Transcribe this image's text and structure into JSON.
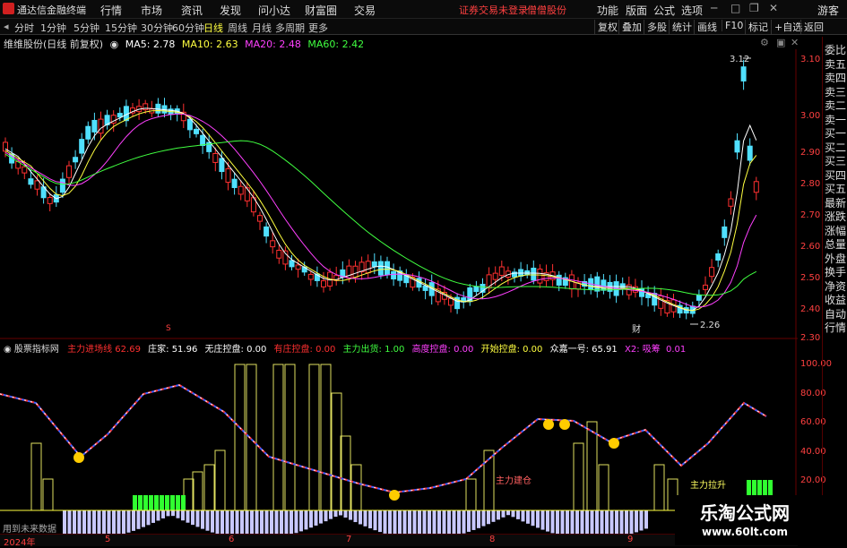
{
  "titlebar": {
    "app_name": "通达信金融终端",
    "menu": [
      "行情",
      "市场",
      "资讯",
      "发现",
      "问小达",
      "财富圈",
      "交易"
    ],
    "notice": "证券交易未登录",
    "notice2": "僧僧股份",
    "right": [
      "功能",
      "版面",
      "公式",
      "选项",
      "游客"
    ]
  },
  "periodbar": {
    "periods": [
      "分时",
      "1分钟",
      "5分钟",
      "15分钟",
      "30分钟",
      "60分钟",
      "日线",
      "周线",
      "月线",
      "多周期",
      "更多"
    ],
    "active": "日线",
    "right": [
      "复权",
      "叠加",
      "多股",
      "统计",
      "画线",
      "F10",
      "标记",
      "+自选",
      "返回"
    ]
  },
  "ma_legend": {
    "title": "维维股份(日线 前复权)",
    "ma5": "MA5: 2.78",
    "ma10": "MA10: 2.63",
    "ma20": "MA20: 2.48",
    "ma60": "MA60: 2.42",
    "colors": {
      "ma5": "#ffffff",
      "ma10": "#ffff40",
      "ma20": "#ff40ff",
      "ma60": "#40ff40"
    }
  },
  "price_axis": [
    "3.10",
    "3.00",
    "2.90",
    "2.80",
    "2.70",
    "2.60",
    "2.50",
    "2.40",
    "2.30"
  ],
  "price_annotations": {
    "high": "3.12",
    "low": "2.26"
  },
  "chart_markers": {
    "s_marker": "S",
    "cai_marker": "财"
  },
  "right_panel": [
    "委比",
    "卖五",
    "卖四",
    "卖三",
    "卖二",
    "卖一",
    "买一",
    "买二",
    "买三",
    "买四",
    "买五",
    "最新",
    "涨跌",
    "涨幅",
    "总量",
    "外盘",
    "换手",
    "净资",
    "收益",
    "自动",
    "行情"
  ],
  "indicator_legend": {
    "name": "股票指标网",
    "items": [
      {
        "label": "主力进场线",
        "value": "62.69",
        "color": "#ff3030"
      },
      {
        "label": "庄家:",
        "value": "51.96",
        "color": "#ffffff"
      },
      {
        "label": "无庄控盘:",
        "value": "0.00",
        "color": "#ffffff"
      },
      {
        "label": "有庄控盘:",
        "value": "0.00",
        "color": "#ff3030"
      },
      {
        "label": "主力出货:",
        "value": "1.00",
        "color": "#40ff40"
      },
      {
        "label": "高度控盘:",
        "value": "0.00",
        "color": "#ff40ff"
      },
      {
        "label": "开始控盘:",
        "value": "0.00",
        "color": "#ffff40"
      },
      {
        "label": "众嘉一号:",
        "value": "65.91",
        "color": "#ffffff"
      },
      {
        "label": "X2:",
        "value": "吸筹",
        "color": "#ff40ff"
      },
      {
        "label": "",
        "value": "0.01",
        "color": "#ff40ff"
      }
    ]
  },
  "indicator_axis": [
    "100.00",
    "80.00",
    "60.00",
    "40.00",
    "20.00"
  ],
  "indicator_annotations": {
    "main_entry": "主力建仓",
    "main_control": "主力拉升",
    "future_data": "用到未来数据"
  },
  "time_axis": [
    "2024年",
    "5",
    "6",
    "7",
    "8",
    "9"
  ],
  "watermark": {
    "title": "乐淘公式网",
    "url": "www.60lt.com"
  }
}
